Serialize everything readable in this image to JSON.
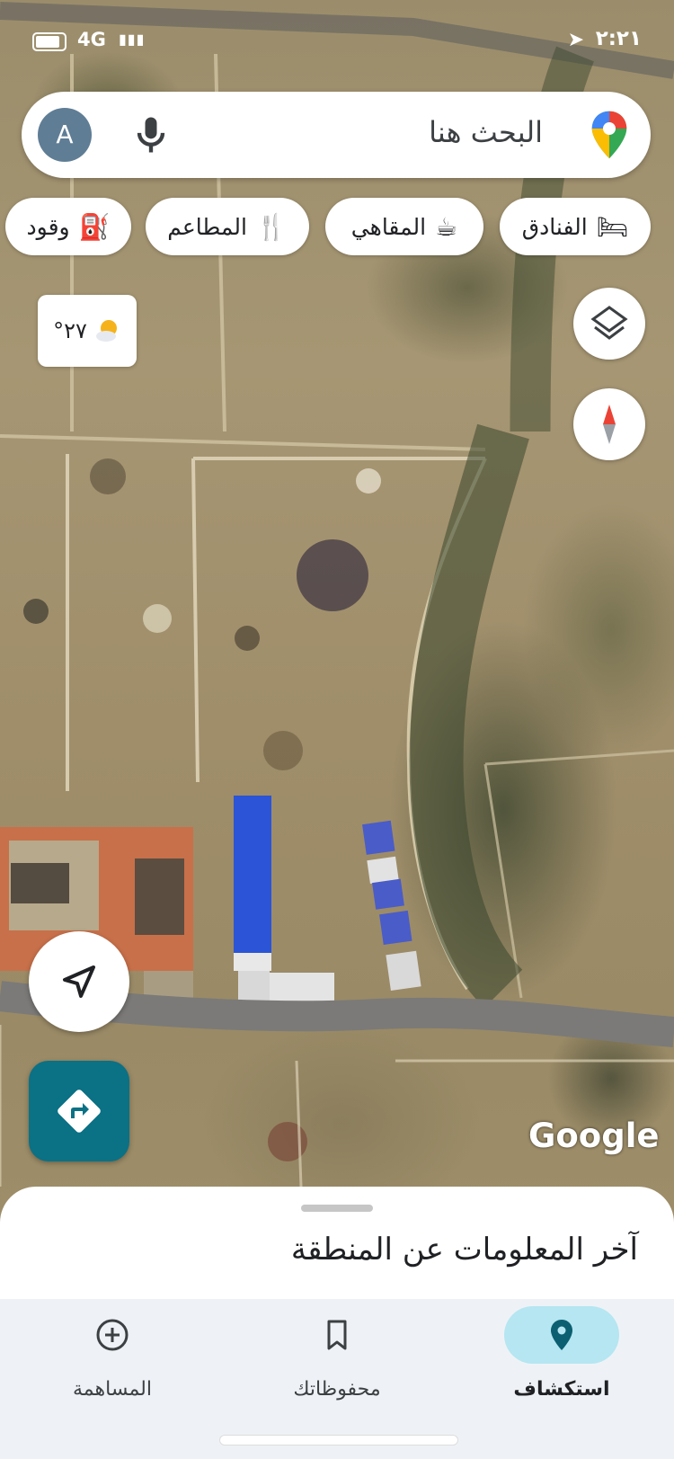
{
  "status_bar": {
    "network": "4G",
    "time": "٢:٢١"
  },
  "search": {
    "avatar_letter": "A",
    "placeholder": "البحث هنا"
  },
  "chips": [
    {
      "label": "الفنادق",
      "icon": "hotel-icon"
    },
    {
      "label": "المقاهي",
      "icon": "coffee-icon"
    },
    {
      "label": "المطاعم",
      "icon": "restaurant-icon"
    },
    {
      "label": "وقود",
      "icon": "gas-station-icon"
    }
  ],
  "weather": {
    "temp": "°٢٧",
    "icon": "partly-sunny-icon"
  },
  "map": {
    "attribution": "Google",
    "layer_icon": "layers-icon",
    "compass_icon": "compass-icon"
  },
  "bottom_sheet": {
    "title": "آخر المعلومات عن المنطقة"
  },
  "bottom_nav": [
    {
      "label": "استكشاف",
      "icon": "explore-pin-icon",
      "active": true
    },
    {
      "label": "محفوظاتك",
      "icon": "bookmark-icon",
      "active": false
    },
    {
      "label": "المساهمة",
      "icon": "add-circle-icon",
      "active": false
    }
  ],
  "colors": {
    "accent": "#0b7185",
    "active_tab_bg": "#b5e6f1"
  }
}
